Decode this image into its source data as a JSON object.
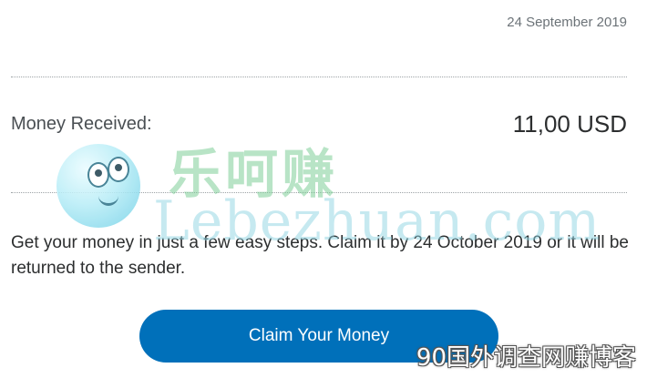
{
  "header": {
    "date": "24 September 2019"
  },
  "payment": {
    "label": "Money Received:",
    "amount": "11,00 USD"
  },
  "instructions": {
    "text": "Get your money in just a few easy steps. Claim it by 24 October 2019 or it will be returned to the sender."
  },
  "cta": {
    "label": "Claim Your Money",
    "color": "#0070ba"
  },
  "watermark": {
    "mascot_icon": "smiling-ball-mascot",
    "cn_text": "乐呵赚",
    "latin_text": "Lebezhuan.com",
    "bottom_text": "90国外调查网赚博客"
  }
}
